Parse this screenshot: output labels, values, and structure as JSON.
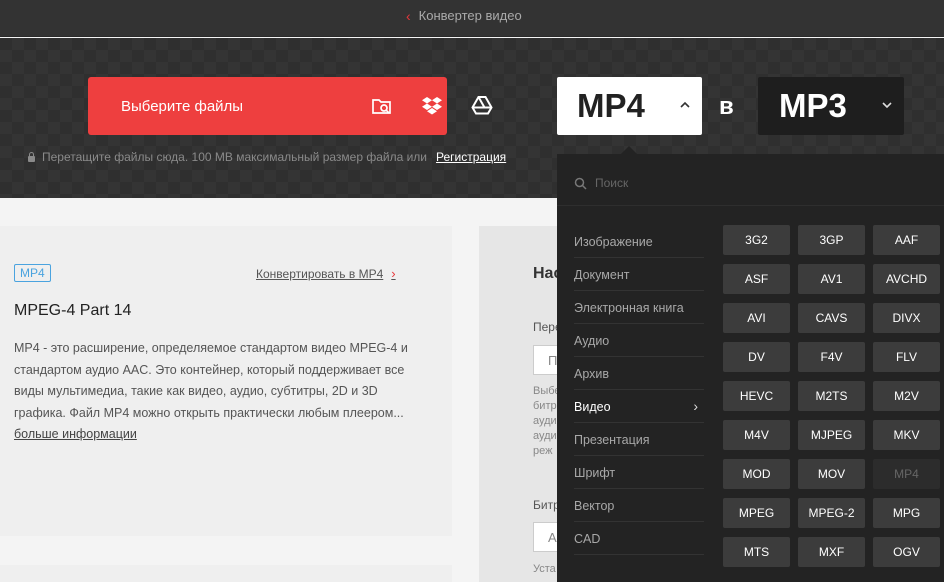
{
  "header": {
    "breadcrumb": "Конвертер видео"
  },
  "upload": {
    "choose_label": "Выберите файлы",
    "hint": "Перетащите файлы сюда. 100 MB максимальный размер файла или",
    "register_link": "Регистрация"
  },
  "converter": {
    "from": "MP4",
    "to_word": "в",
    "to": "MP3"
  },
  "info": {
    "tag": "MP4",
    "convert_link": "Конвертировать в MP4",
    "title": "MPEG-4 Part 14",
    "description": "MP4 - это расширение, определяемое стандартом видео MPEG-4 и стандартом аудио AAC. Это контейнер, который поддерживает все виды мультимедиа, такие как видео, аудио, субтитры, 2D и 3D графика. Файл MP4 можно открыть практически любым плеером...",
    "more_link": "больше информации"
  },
  "settings": {
    "heading": "Нас",
    "label1": "Пере",
    "input1": "П",
    "text": "Выбе битр ауди ауди реж",
    "label2": "Битр",
    "input2": "А",
    "label3": "Уста"
  },
  "dropdown": {
    "search_placeholder": "Поиск",
    "categories": [
      "Изображение",
      "Документ",
      "Электронная книга",
      "Аудио",
      "Архив",
      "Видео",
      "Презентация",
      "Шрифт",
      "Вектор",
      "CAD"
    ],
    "active_category": "Видео",
    "formats": [
      "3G2",
      "3GP",
      "AAF",
      "ASF",
      "AV1",
      "AVCHD",
      "AVI",
      "CAVS",
      "DIVX",
      "DV",
      "F4V",
      "FLV",
      "HEVC",
      "M2TS",
      "M2V",
      "M4V",
      "MJPEG",
      "MKV",
      "MOD",
      "MOV",
      "MP4",
      "MPEG",
      "MPEG-2",
      "MPG",
      "MTS",
      "MXF",
      "OGV"
    ],
    "disabled_format": "MP4"
  },
  "colors": {
    "accent": "#ee3f3f",
    "link_blue": "#4aa3df",
    "dropdown_bg": "#232323",
    "format_btn": "#3c3c3c"
  }
}
